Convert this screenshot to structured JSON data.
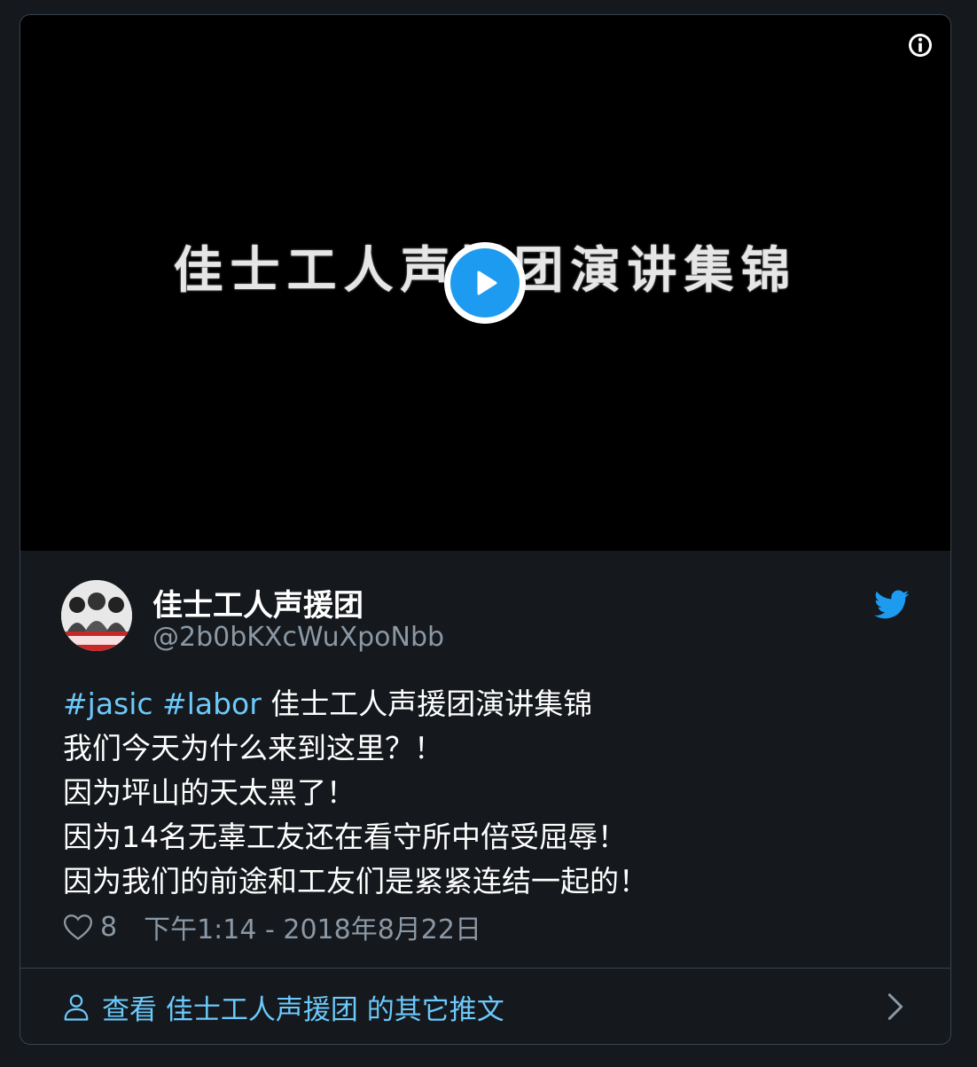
{
  "video": {
    "title_text": "佳士工人声援团演讲集锦",
    "info_icon": "info-icon",
    "play_icon": "play-icon"
  },
  "author": {
    "name": "佳士工人声援团",
    "handle": "@2b0bKXcWuXpoNbb",
    "avatar_icon": "avatar"
  },
  "tweet": {
    "hashtags": [
      "#jasic",
      "#labor"
    ],
    "line1_rest": "佳士工人声援团演讲集锦",
    "lines": [
      "我们今天为什么来到这里？！",
      "因为坪山的天太黑了！",
      "因为14名无辜工友还在看守所中倍受屈辱！",
      "因为我们的前途和工友们是紧紧连结一起的！"
    ]
  },
  "meta": {
    "likes": "8",
    "timestamp": "下午1:14 - 2018年8月22日"
  },
  "footer": {
    "more_text": "查看 佳士工人声援团 的其它推文"
  },
  "colors": {
    "background": "#15181c",
    "accent": "#1d9bf0",
    "link": "#6bc9fb",
    "muted": "#8b98a5",
    "border": "#38444d"
  }
}
